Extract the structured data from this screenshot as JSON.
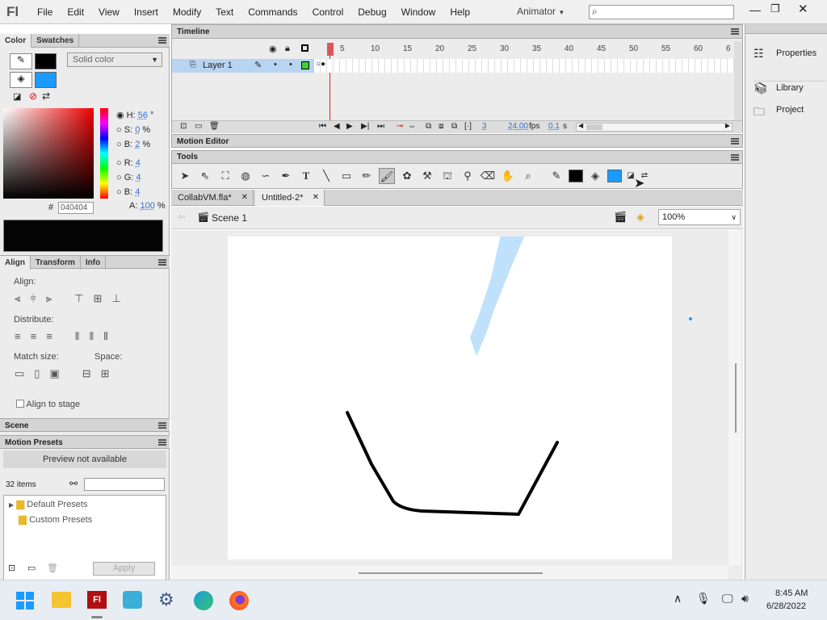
{
  "app": {
    "logo": "Fl",
    "workspace": "Animator"
  },
  "menu": [
    "File",
    "Edit",
    "View",
    "Insert",
    "Modify",
    "Text",
    "Commands",
    "Control",
    "Debug",
    "Window",
    "Help"
  ],
  "color_panel": {
    "tabs": [
      "Color",
      "Swatches"
    ],
    "fill_type": "Solid color",
    "stroke_color": "#000000",
    "fill_color": "#1a9bff",
    "hsb": [
      {
        "label": "H:",
        "value": "56",
        "unit": "°"
      },
      {
        "label": "S:",
        "value": "0",
        "unit": "%"
      },
      {
        "label": "B:",
        "value": "2",
        "unit": "%"
      }
    ],
    "rgb": [
      {
        "label": "R:",
        "value": "4"
      },
      {
        "label": "G:",
        "value": "4"
      },
      {
        "label": "B:",
        "value": "4"
      }
    ],
    "alpha_label": "A:",
    "alpha_value": "100",
    "alpha_unit": "%",
    "hex_label": "#",
    "hex": "040404"
  },
  "align_panel": {
    "tabs": [
      "Align",
      "Transform",
      "Info"
    ],
    "align_label": "Align:",
    "distribute_label": "Distribute:",
    "match_label": "Match size:",
    "space_label": "Space:",
    "align_to_stage": "Align to stage"
  },
  "scene_panel": {
    "title": "Scene"
  },
  "motion_presets": {
    "title": "Motion Presets",
    "preview": "Preview not available",
    "count": "32 items",
    "items": [
      "Default Presets",
      "Custom Presets"
    ],
    "apply": "Apply"
  },
  "timeline": {
    "title": "Timeline",
    "layer": "Layer 1",
    "frame_numbers": [
      "5",
      "10",
      "15",
      "20",
      "25",
      "30",
      "35",
      "40",
      "45",
      "50",
      "55",
      "60",
      "6"
    ],
    "current_frame": "3",
    "fps": "24.00",
    "fps_unit": "fps",
    "time": "0.1",
    "time_unit": "s"
  },
  "motion_editor": {
    "title": "Motion Editor"
  },
  "tools": {
    "title": "Tools",
    "fill_color": "#1a9bff",
    "stroke_color": "#000000"
  },
  "doc_tabs": [
    {
      "label": "CollabVM.fla*"
    },
    {
      "label": "Untitled-2*"
    }
  ],
  "scene_bar": {
    "scene": "Scene 1",
    "zoom": "100%"
  },
  "right_panel": {
    "items": [
      "Properties",
      "Library",
      "Project"
    ]
  },
  "taskbar": {
    "time": "8:45 AM",
    "date": "6/28/2022"
  },
  "colors": {
    "accent": "#1a9bff",
    "panel": "#ececec",
    "header": "#d4d4d4"
  }
}
